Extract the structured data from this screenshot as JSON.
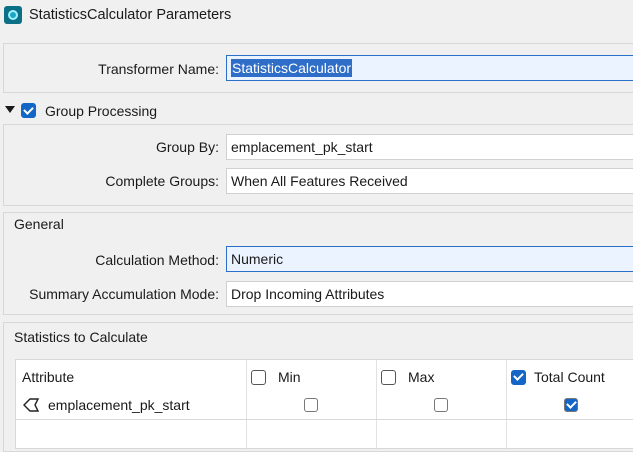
{
  "window": {
    "title": "StatisticsCalculator Parameters",
    "icon": "fme-transformer-icon"
  },
  "transformer": {
    "label": "Transformer Name:",
    "value": "StatisticsCalculator"
  },
  "group_processing": {
    "label": "Group Processing",
    "enabled": true,
    "group_by": {
      "label": "Group By:",
      "value": "emplacement_pk_start"
    },
    "complete_groups": {
      "label": "Complete Groups:",
      "value": "When All Features Received"
    }
  },
  "general": {
    "title": "General",
    "calculation_method": {
      "label": "Calculation Method:",
      "value": "Numeric"
    },
    "summary_mode": {
      "label": "Summary Accumulation Mode:",
      "value": "Drop Incoming Attributes"
    }
  },
  "statistics": {
    "title": "Statistics to Calculate",
    "columns": [
      {
        "label": "Attribute"
      },
      {
        "label": "Min",
        "checked": false
      },
      {
        "label": "Max",
        "checked": false
      },
      {
        "label": "Total Count",
        "checked": true
      }
    ],
    "rows": [
      {
        "attribute": "emplacement_pk_start",
        "min": false,
        "max": false,
        "total_count": true
      }
    ]
  },
  "colors": {
    "accent": "#1466c6",
    "selection": "#2f6ec8",
    "background": "#f0f0f0"
  }
}
